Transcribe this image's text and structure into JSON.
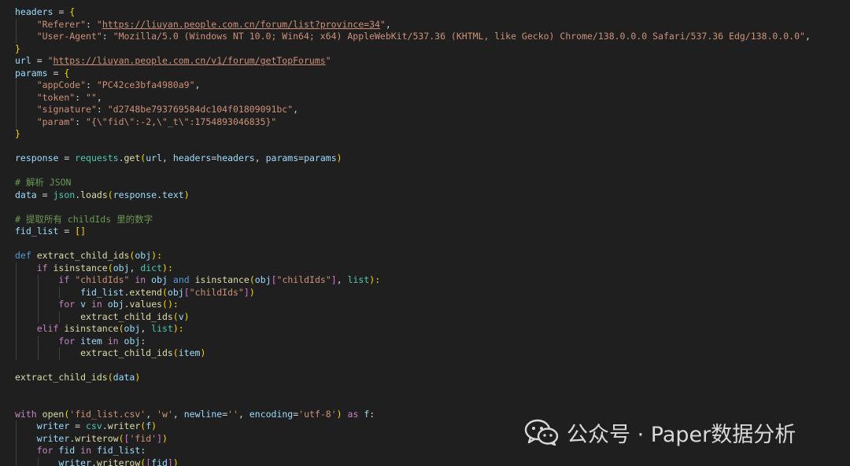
{
  "editor": {
    "theme_colors": {
      "background": "#1f1f1f",
      "variable": "#9cdcfe",
      "string": "#ce9178",
      "keyword": "#c586c0",
      "function": "#dcdcaa",
      "comment": "#6a9955",
      "bracket_level1": "#ffd700",
      "bracket_level2": "#da70d6",
      "bracket_level3": "#179fff"
    },
    "lines": [
      [
        [
          "headers",
          "var"
        ],
        [
          " = ",
          "op"
        ],
        [
          "{",
          "br1"
        ]
      ],
      [
        [
          "    ",
          "op"
        ],
        [
          "\"Referer\"",
          "str"
        ],
        [
          ": ",
          "op"
        ],
        [
          "\"",
          "str"
        ],
        [
          "https://liuyan.people.com.cn/forum/list?province=34",
          "str-u"
        ],
        [
          "\"",
          "str"
        ],
        [
          ",",
          "op"
        ]
      ],
      [
        [
          "    ",
          "op"
        ],
        [
          "\"User-Agent\"",
          "str"
        ],
        [
          ": ",
          "op"
        ],
        [
          "\"Mozilla/5.0 (Windows NT 10.0; Win64; x64) AppleWebKit/537.36 (KHTML, like Gecko) Chrome/138.0.0.0 Safari/537.36 Edg/138.0.0.0\"",
          "str"
        ],
        [
          ",",
          "op"
        ]
      ],
      [
        [
          "}",
          "br1"
        ]
      ],
      [
        [
          "url",
          "var"
        ],
        [
          " = ",
          "op"
        ],
        [
          "\"",
          "str"
        ],
        [
          "https://liuyan.people.com.cn/v1/forum/getTopForums",
          "str-u"
        ],
        [
          "\"",
          "str"
        ]
      ],
      [
        [
          "params",
          "var"
        ],
        [
          " = ",
          "op"
        ],
        [
          "{",
          "br1"
        ]
      ],
      [
        [
          "    ",
          "op"
        ],
        [
          "\"appCode\"",
          "str"
        ],
        [
          ": ",
          "op"
        ],
        [
          "\"PC42ce3bfa4980a9\"",
          "str"
        ],
        [
          ",",
          "op"
        ]
      ],
      [
        [
          "    ",
          "op"
        ],
        [
          "\"token\"",
          "str"
        ],
        [
          ": ",
          "op"
        ],
        [
          "\"\"",
          "str"
        ],
        [
          ",",
          "op"
        ]
      ],
      [
        [
          "    ",
          "op"
        ],
        [
          "\"signature\"",
          "str"
        ],
        [
          ": ",
          "op"
        ],
        [
          "\"d2748be793769584dc104f01809091bc\"",
          "str"
        ],
        [
          ",",
          "op"
        ]
      ],
      [
        [
          "    ",
          "op"
        ],
        [
          "\"param\"",
          "str"
        ],
        [
          ": ",
          "op"
        ],
        [
          "\"{\\\"fid\\\":-2,\\\"_t\\\":1754893046835}\"",
          "str"
        ]
      ],
      [
        [
          "}",
          "br1"
        ]
      ],
      [],
      [
        [
          "response",
          "var"
        ],
        [
          " = ",
          "op"
        ],
        [
          "requests",
          "mod"
        ],
        [
          ".",
          "op"
        ],
        [
          "get",
          "fn"
        ],
        [
          "(",
          "br1"
        ],
        [
          "url",
          "var"
        ],
        [
          ", ",
          "op"
        ],
        [
          "headers",
          "param"
        ],
        [
          "=",
          "op"
        ],
        [
          "headers",
          "var"
        ],
        [
          ", ",
          "op"
        ],
        [
          "params",
          "param"
        ],
        [
          "=",
          "op"
        ],
        [
          "params",
          "var"
        ],
        [
          ")",
          "br1"
        ]
      ],
      [],
      [
        [
          "# 解析 JSON",
          "cmt"
        ]
      ],
      [
        [
          "data",
          "var"
        ],
        [
          " = ",
          "op"
        ],
        [
          "json",
          "mod"
        ],
        [
          ".",
          "op"
        ],
        [
          "loads",
          "fn"
        ],
        [
          "(",
          "br1"
        ],
        [
          "response",
          "var"
        ],
        [
          ".",
          "op"
        ],
        [
          "text",
          "var"
        ],
        [
          ")",
          "br1"
        ]
      ],
      [],
      [
        [
          "# 提取所有 childIds 里的数字",
          "cmt"
        ]
      ],
      [
        [
          "fid_list",
          "var"
        ],
        [
          " = ",
          "op"
        ],
        [
          "[]",
          "br1"
        ]
      ],
      [],
      [
        [
          "def",
          "dec"
        ],
        [
          " ",
          "op"
        ],
        [
          "extract_child_ids",
          "fn"
        ],
        [
          "(",
          "br1"
        ],
        [
          "obj",
          "param"
        ],
        [
          "):",
          "br1"
        ]
      ],
      [
        [
          "    ",
          "op"
        ],
        [
          "if",
          "kw"
        ],
        [
          " ",
          "op"
        ],
        [
          "isinstance",
          "fn"
        ],
        [
          "(",
          "br1"
        ],
        [
          "obj",
          "var"
        ],
        [
          ", ",
          "op"
        ],
        [
          "dict",
          "mod"
        ],
        [
          "):",
          "br1"
        ]
      ],
      [
        [
          "        ",
          "op"
        ],
        [
          "if",
          "kw"
        ],
        [
          " ",
          "op"
        ],
        [
          "\"childIds\"",
          "str"
        ],
        [
          " ",
          "op"
        ],
        [
          "in",
          "kw"
        ],
        [
          " ",
          "op"
        ],
        [
          "obj",
          "var"
        ],
        [
          " ",
          "op"
        ],
        [
          "and",
          "dec"
        ],
        [
          " ",
          "op"
        ],
        [
          "isinstance",
          "fn"
        ],
        [
          "(",
          "br1"
        ],
        [
          "obj",
          "var"
        ],
        [
          "[",
          "br2"
        ],
        [
          "\"childIds\"",
          "str"
        ],
        [
          "]",
          "br2"
        ],
        [
          ", ",
          "op"
        ],
        [
          "list",
          "mod"
        ],
        [
          "):",
          "br1"
        ]
      ],
      [
        [
          "            ",
          "op"
        ],
        [
          "fid_list",
          "var"
        ],
        [
          ".",
          "op"
        ],
        [
          "extend",
          "fn"
        ],
        [
          "(",
          "br1"
        ],
        [
          "obj",
          "var"
        ],
        [
          "[",
          "br2"
        ],
        [
          "\"childIds\"",
          "str"
        ],
        [
          "]",
          "br2"
        ],
        [
          ")",
          "br1"
        ]
      ],
      [
        [
          "        ",
          "op"
        ],
        [
          "for",
          "kw"
        ],
        [
          " ",
          "op"
        ],
        [
          "v",
          "var"
        ],
        [
          " ",
          "op"
        ],
        [
          "in",
          "kw"
        ],
        [
          " ",
          "op"
        ],
        [
          "obj",
          "var"
        ],
        [
          ".",
          "op"
        ],
        [
          "values",
          "fn"
        ],
        [
          "():",
          "br1"
        ]
      ],
      [
        [
          "            ",
          "op"
        ],
        [
          "extract_child_ids",
          "fn"
        ],
        [
          "(",
          "br1"
        ],
        [
          "v",
          "var"
        ],
        [
          ")",
          "br1"
        ]
      ],
      [
        [
          "    ",
          "op"
        ],
        [
          "elif",
          "kw"
        ],
        [
          " ",
          "op"
        ],
        [
          "isinstance",
          "fn"
        ],
        [
          "(",
          "br1"
        ],
        [
          "obj",
          "var"
        ],
        [
          ", ",
          "op"
        ],
        [
          "list",
          "mod"
        ],
        [
          "):",
          "br1"
        ]
      ],
      [
        [
          "        ",
          "op"
        ],
        [
          "for",
          "kw"
        ],
        [
          " ",
          "op"
        ],
        [
          "item",
          "var"
        ],
        [
          " ",
          "op"
        ],
        [
          "in",
          "kw"
        ],
        [
          " ",
          "op"
        ],
        [
          "obj",
          "var"
        ],
        [
          ":",
          "op"
        ]
      ],
      [
        [
          "            ",
          "op"
        ],
        [
          "extract_child_ids",
          "fn"
        ],
        [
          "(",
          "br1"
        ],
        [
          "item",
          "var"
        ],
        [
          ")",
          "br1"
        ]
      ],
      [],
      [
        [
          "extract_child_ids",
          "fn"
        ],
        [
          "(",
          "br1"
        ],
        [
          "data",
          "var"
        ],
        [
          ")",
          "br1"
        ]
      ],
      [],
      [],
      [
        [
          "with",
          "kw"
        ],
        [
          " ",
          "op"
        ],
        [
          "open",
          "fn"
        ],
        [
          "(",
          "br1"
        ],
        [
          "'fid_list.csv'",
          "str"
        ],
        [
          ", ",
          "op"
        ],
        [
          "'w'",
          "str"
        ],
        [
          ", ",
          "op"
        ],
        [
          "newline",
          "param"
        ],
        [
          "=",
          "op"
        ],
        [
          "''",
          "str"
        ],
        [
          ", ",
          "op"
        ],
        [
          "encoding",
          "param"
        ],
        [
          "=",
          "op"
        ],
        [
          "'utf-8'",
          "str"
        ],
        [
          ")",
          "br1"
        ],
        [
          " ",
          "op"
        ],
        [
          "as",
          "kw"
        ],
        [
          " ",
          "op"
        ],
        [
          "f",
          "var"
        ],
        [
          ":",
          "op"
        ]
      ],
      [
        [
          "    ",
          "op"
        ],
        [
          "writer",
          "var"
        ],
        [
          " = ",
          "op"
        ],
        [
          "csv",
          "mod"
        ],
        [
          ".",
          "op"
        ],
        [
          "writer",
          "fn"
        ],
        [
          "(",
          "br1"
        ],
        [
          "f",
          "var"
        ],
        [
          ")",
          "br1"
        ]
      ],
      [
        [
          "    ",
          "op"
        ],
        [
          "writer",
          "var"
        ],
        [
          ".",
          "op"
        ],
        [
          "writerow",
          "fn"
        ],
        [
          "(",
          "br1"
        ],
        [
          "[",
          "br2"
        ],
        [
          "'fid'",
          "str"
        ],
        [
          "]",
          "br2"
        ],
        [
          ")",
          "br1"
        ]
      ],
      [
        [
          "    ",
          "op"
        ],
        [
          "for",
          "kw"
        ],
        [
          " ",
          "op"
        ],
        [
          "fid",
          "var"
        ],
        [
          " ",
          "op"
        ],
        [
          "in",
          "kw"
        ],
        [
          " ",
          "op"
        ],
        [
          "fid_list",
          "var"
        ],
        [
          ":",
          "op"
        ]
      ],
      [
        [
          "        ",
          "op"
        ],
        [
          "writer",
          "var"
        ],
        [
          ".",
          "op"
        ],
        [
          "writerow",
          "fn"
        ],
        [
          "(",
          "br1"
        ],
        [
          "[",
          "br2"
        ],
        [
          "fid",
          "var"
        ],
        [
          "]",
          "br2"
        ],
        [
          ")",
          "br1"
        ]
      ]
    ]
  },
  "watermark": {
    "text": "公众号 · Paper数据分析",
    "icon": "wechat-icon"
  }
}
